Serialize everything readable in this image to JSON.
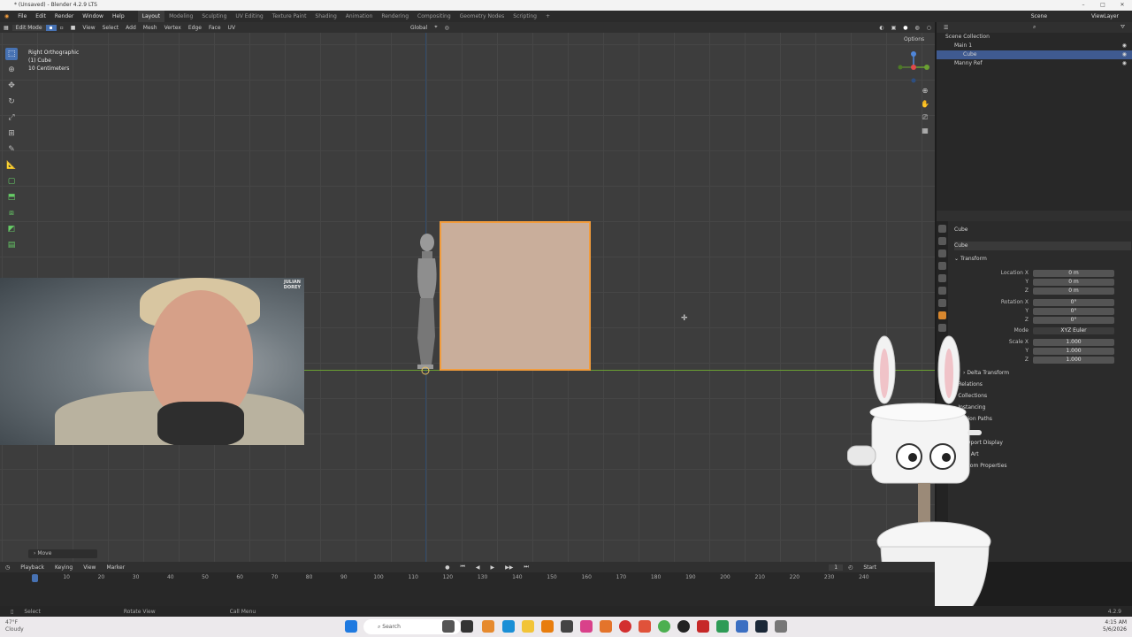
{
  "window": {
    "title": "* (Unsaved) - Blender 4.2.9 LTS",
    "controls": [
      "–",
      "□",
      "✕"
    ]
  },
  "menu": [
    "File",
    "Edit",
    "Render",
    "Window",
    "Help"
  ],
  "workspaces": [
    "Layout",
    "Modeling",
    "Sculpting",
    "UV Editing",
    "Texture Paint",
    "Shading",
    "Animation",
    "Rendering",
    "Compositing",
    "Geometry Nodes",
    "Scripting"
  ],
  "active_workspace": "Layout",
  "scene": {
    "label": "Scene",
    "view_layer": "ViewLayer"
  },
  "header": {
    "mode": "Edit Mode",
    "items": [
      "View",
      "Select",
      "Add",
      "Mesh",
      "Vertex",
      "Edge",
      "Face",
      "UV"
    ],
    "orientation": "Global",
    "options": "Options"
  },
  "viewport": {
    "view_name": "Right Orthographic",
    "object": "(1) Cube",
    "scale": "10 Centimeters"
  },
  "webcam": {
    "brand_line1": "JULIAN",
    "brand_line2": "DOREY"
  },
  "outliner": {
    "root": "Scene Collection",
    "rows": [
      {
        "label": "Main 1",
        "selected": false
      },
      {
        "label": "Cube",
        "selected": true
      },
      {
        "label": "Manny Ref",
        "selected": false
      }
    ]
  },
  "properties": {
    "object_name": "Cube",
    "data_name": "Cube",
    "transform_label": "Transform",
    "location": {
      "label": "Location X",
      "x": "0 m",
      "y": "0 m",
      "z": "0 m"
    },
    "rotation": {
      "label": "Rotation X",
      "x": "0°",
      "y": "0°",
      "z": "0°"
    },
    "mode": {
      "label": "Mode",
      "value": "XYZ Euler"
    },
    "scale": {
      "label": "Scale X",
      "x": "1.000",
      "y": "1.000",
      "z": "1.000"
    },
    "axis_y": "Y",
    "axis_z": "Z",
    "sections": [
      "Delta Transform",
      "Relations",
      "Collections",
      "Instancing",
      "Motion Paths",
      "Viewport Display",
      "Line Art",
      "Custom Properties"
    ]
  },
  "timeline": {
    "header": [
      "Playback",
      "Keying",
      "View",
      "Marker"
    ],
    "current_frame": "1",
    "start_label": "Start",
    "ticks": [
      "1",
      "10",
      "20",
      "30",
      "40",
      "50",
      "60",
      "70",
      "80",
      "90",
      "100",
      "110",
      "120",
      "130",
      "140",
      "150",
      "160",
      "170",
      "180",
      "190",
      "200",
      "210",
      "220",
      "230",
      "240"
    ]
  },
  "move_panel": "Move",
  "status": [
    "Select",
    "Rotate View",
    "Call Menu"
  ],
  "version": "4.2.9",
  "taskbar": {
    "search": "Search",
    "weather": "47°F",
    "weather_sub": "Cloudy",
    "time": "4:15 AM",
    "date": "5/6/2026"
  },
  "colors": {
    "selection": "#f29c3c",
    "active": "#4772b3",
    "cube_face": "#c9ae9b",
    "ground_axis": "#6aa032"
  }
}
